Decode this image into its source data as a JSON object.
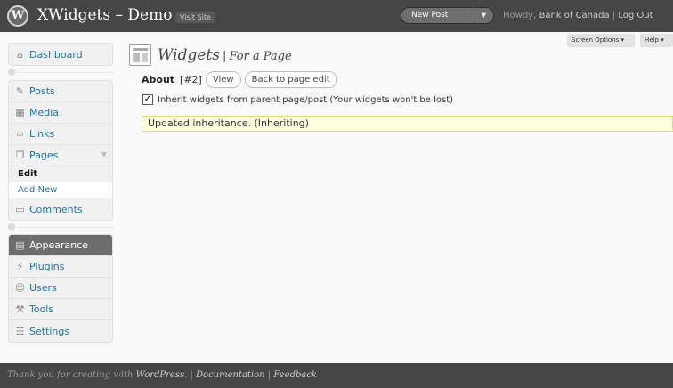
{
  "header": {
    "logo": "W",
    "site_title": "XWidgets – Demo",
    "visit_site": "Visit Site",
    "new_post": "New Post",
    "howdy_prefix": "Howdy, ",
    "user": "Bank of Canada",
    "separator": " | ",
    "logout": "Log Out"
  },
  "screen_meta": {
    "screen_options": "Screen Options",
    "help": "Help"
  },
  "sidebar": {
    "dashboard": "Dashboard",
    "posts": "Posts",
    "media": "Media",
    "links": "Links",
    "pages": "Pages",
    "pages_sub": {
      "edit": "Edit",
      "add_new": "Add New"
    },
    "comments": "Comments",
    "appearance": "Appearance",
    "plugins": "Plugins",
    "users": "Users",
    "tools": "Tools",
    "settings": "Settings"
  },
  "main": {
    "title": "Widgets",
    "title_sep": "|",
    "subtitle": "For a Page",
    "about_label": "About",
    "page_number": "[#2]",
    "view_button": "View",
    "back_button": "Back to page edit",
    "inherit_checked": true,
    "inherit_label": "Inherit widgets from parent page/post (Your widgets won't be lost)",
    "notice": "Updated inheritance. (Inheriting)"
  },
  "footer": {
    "thanks": "Thank you for creating with ",
    "wordpress": "WordPress",
    "sep1": ". | ",
    "documentation": "Documentation",
    "sep2": " | ",
    "feedback": "Feedback"
  },
  "colors": {
    "header_bg": "#464646",
    "link": "#21759b",
    "notice_bg": "#ffffe0",
    "notice_border": "#e6db55",
    "current_menu_bg": "#6d6d6d"
  },
  "icons": {
    "logo": "wordpress-logo-icon",
    "dashboard": "dashboard-icon",
    "posts": "pin-icon",
    "media": "media-icon",
    "links": "link-icon",
    "pages": "pages-icon",
    "comments": "comment-icon",
    "appearance": "appearance-icon",
    "plugins": "plugin-icon",
    "users": "users-icon",
    "tools": "tools-icon",
    "settings": "settings-icon"
  }
}
